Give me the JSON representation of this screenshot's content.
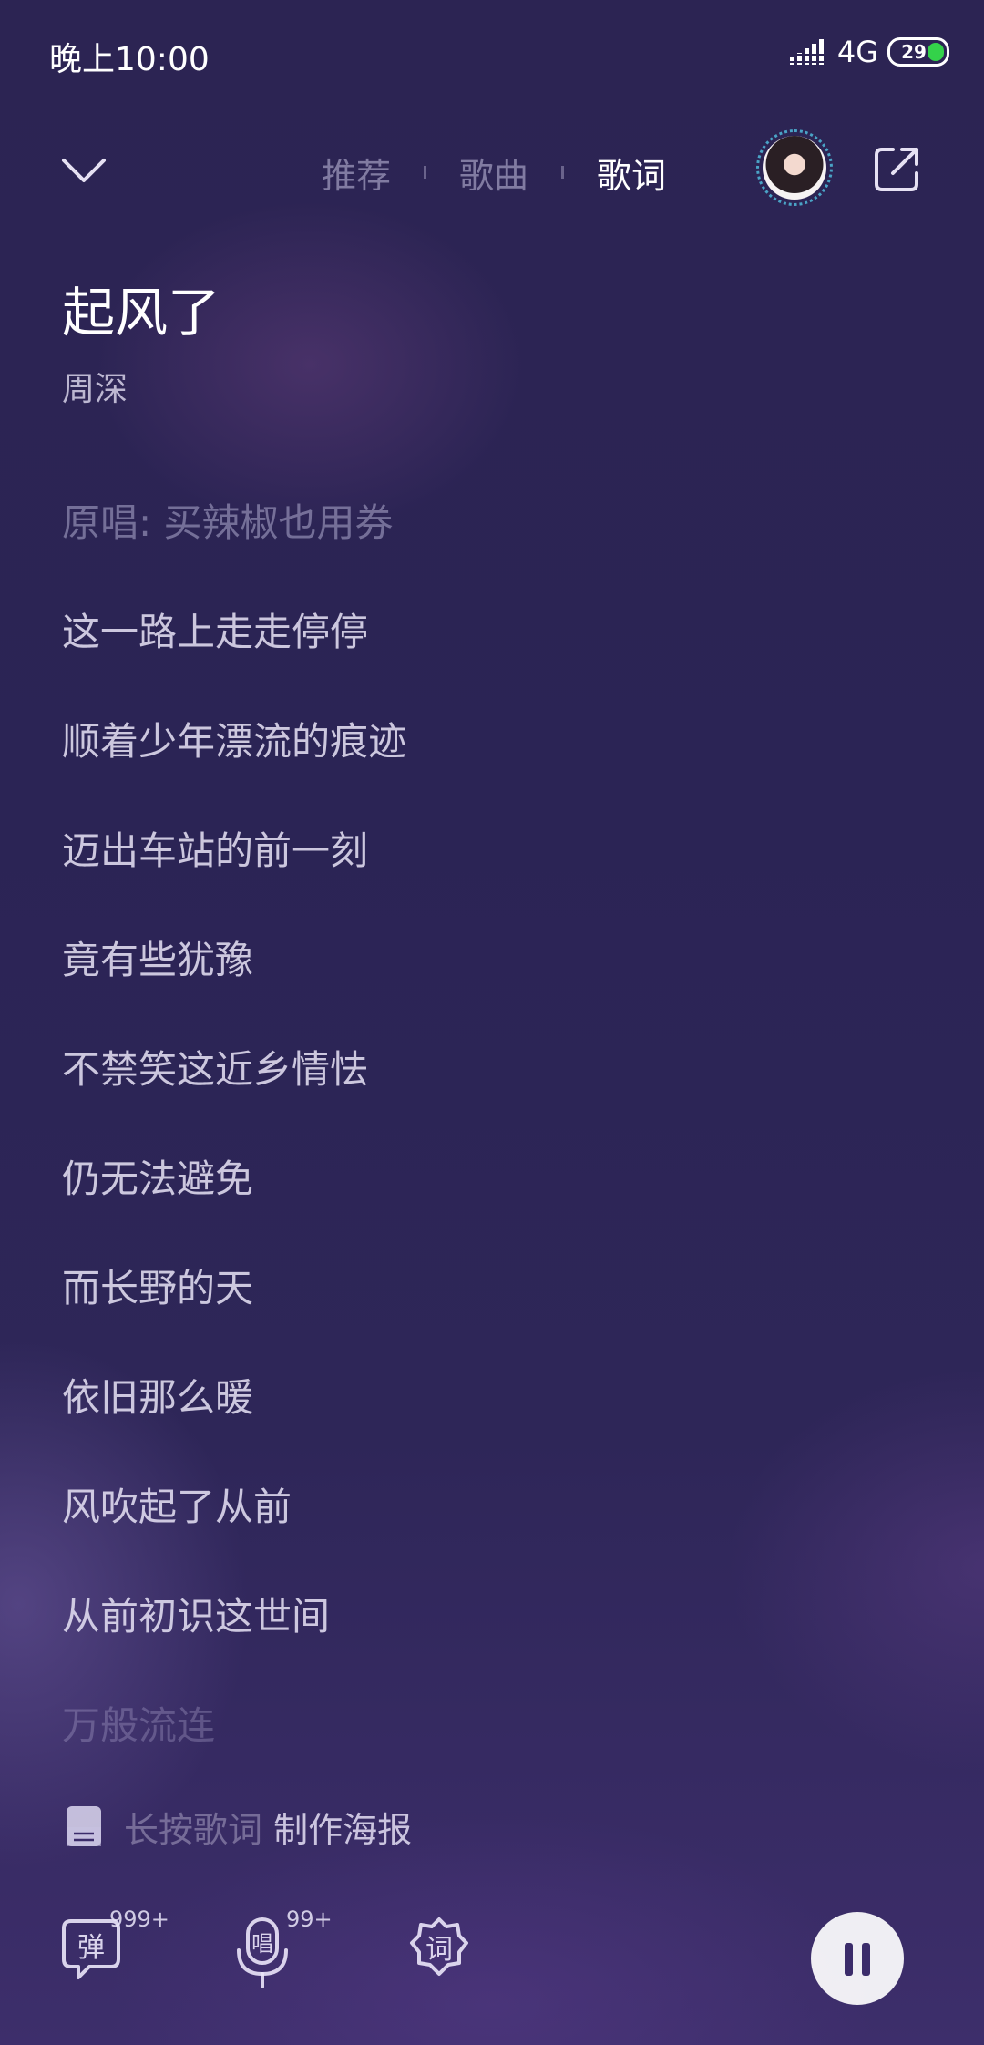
{
  "status_bar": {
    "time": "晚上10:00",
    "network": "4G",
    "battery": "29"
  },
  "nav": {
    "tabs": [
      {
        "label": "推荐",
        "active": false
      },
      {
        "label": "歌曲",
        "active": false
      },
      {
        "label": "歌词",
        "active": true
      }
    ]
  },
  "song": {
    "title": "起风了",
    "artist": "周深"
  },
  "lyrics": [
    "原唱: 买辣椒也用券",
    "这一路上走走停停",
    "顺着少年漂流的痕迹",
    "迈出车站的前一刻",
    "竟有些犹豫",
    "不禁笑这近乡情怯",
    "仍无法避免",
    "而长野的天",
    "依旧那么暖",
    "风吹起了从前",
    "从前初识这世间",
    "万般流连"
  ],
  "poster_hint": {
    "faded": "长按歌词",
    "text": " 制作海报"
  },
  "actions": {
    "danmaku": {
      "glyph": "弹",
      "count": "999+"
    },
    "sing": {
      "glyph": "唱",
      "count": "99+"
    },
    "lyrics": {
      "glyph": "词"
    }
  },
  "colors": {
    "background": "#2b2455",
    "accent_battery": "#34d24a",
    "avatar_ring": "#4aa3c6"
  },
  "icons": [
    "signal-icon",
    "chevron-down-icon",
    "share-icon",
    "poster-icon",
    "danmaku-icon",
    "microphone-icon",
    "lyrics-badge-icon",
    "pause-icon"
  ]
}
